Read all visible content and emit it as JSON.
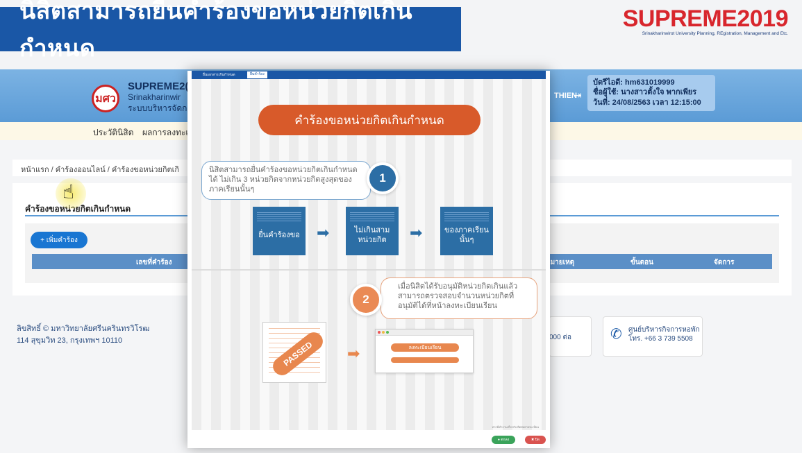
{
  "slide": {
    "banner_title": "นิสิตสามารถยื่นคำร้องขอหน่วยกิตเกินกำหนด",
    "logo_text": "SUPREME2019",
    "logo_subtitle": "Srinakharinwirot University Planning, REgistration, Management and Etc."
  },
  "header": {
    "logo_mark": "มศว",
    "title_line1": "SUPREME2(",
    "title_line2": "Srinakharinwir",
    "title_line3": "ระบบบริหารจัดก",
    "user_label": "THIEN",
    "user_id": "บัตรีไอดี: hm631019999",
    "user_name": "ชื่อผู้ใช้: นางสาวตั้งใจ พากเพียร",
    "datetime": "วันที่: 24/08/2563 เวลา 12:15:00"
  },
  "nav": {
    "items": [
      "ประวัตินิสิต",
      "ผลการลงทะเบ"
    ]
  },
  "breadcrumb": "หน้าแรก  /  คำร้องออนไลน์  /  คำร้องขอหน่วยกิตเกิ",
  "content": {
    "title": "คำร้องขอหน่วยกิตเกินกำหนด",
    "add_button": "+ เพิ่มคำร้อง",
    "table_headers": [
      "เลขที่คำร้อง",
      "หมายเหตุ",
      "ขั้นตอน",
      "จัดการ"
    ]
  },
  "footer": {
    "copyright": "ลิขสิทธิ์ © มหาวิทยาลัยศรีนครินทรวิโรฒ",
    "address": "114 สุขุมวิท 23, กรุงเทพฯ 10110",
    "phone_box_partial": "000 ต่อ",
    "center_name": "ศูนย์บริหารกิจการหอพัก",
    "center_phone": "โทร. +66 3 739 5508"
  },
  "modal": {
    "tab1": "ยื่นเอกสารเกินกำหนด",
    "tab2": "ยื่นคำร้อง",
    "title": "คำร้องขอหน่วยกิตเกินกำหนด",
    "step1_number": "1",
    "step1_text": "นิสิตสามารถยื่นคำร้องขอหน่วยกิตเกินกำหนดได้ ไม่เกิน 3 หน่วยกิตจากหน่วยกิตสูงสุดของภาคเรียนนั้นๆ",
    "flow": [
      "ยื่นคำร้องขอ",
      "ไม่เกินสามหน่วยกิต",
      "ของภาคเรียนนั้นๆ"
    ],
    "step2_number": "2",
    "step2_text": "เมื่อนิสิตได้รับอนุมัติหน่วยกิตเกินแล้ว สามารถตรวจสอบจำนวนหน่วยกิตที่อนุมัติได้ที่หน้าลงทะเบียนเรียน",
    "passed_label": "PASSED",
    "register_button": "ลงทะเบียนเรียน",
    "footnote": "หากมีคำถามเกี่ยวกับ ติดต่อฝ่ายทะเบียน",
    "ok_button": "● ตกลง",
    "close_button": "✖ ปิด"
  },
  "colors": {
    "banner": "#1a57a6",
    "accent_orange": "#d85a2a",
    "accent_blue": "#2c6ea5",
    "logo_red": "#d8262d"
  }
}
